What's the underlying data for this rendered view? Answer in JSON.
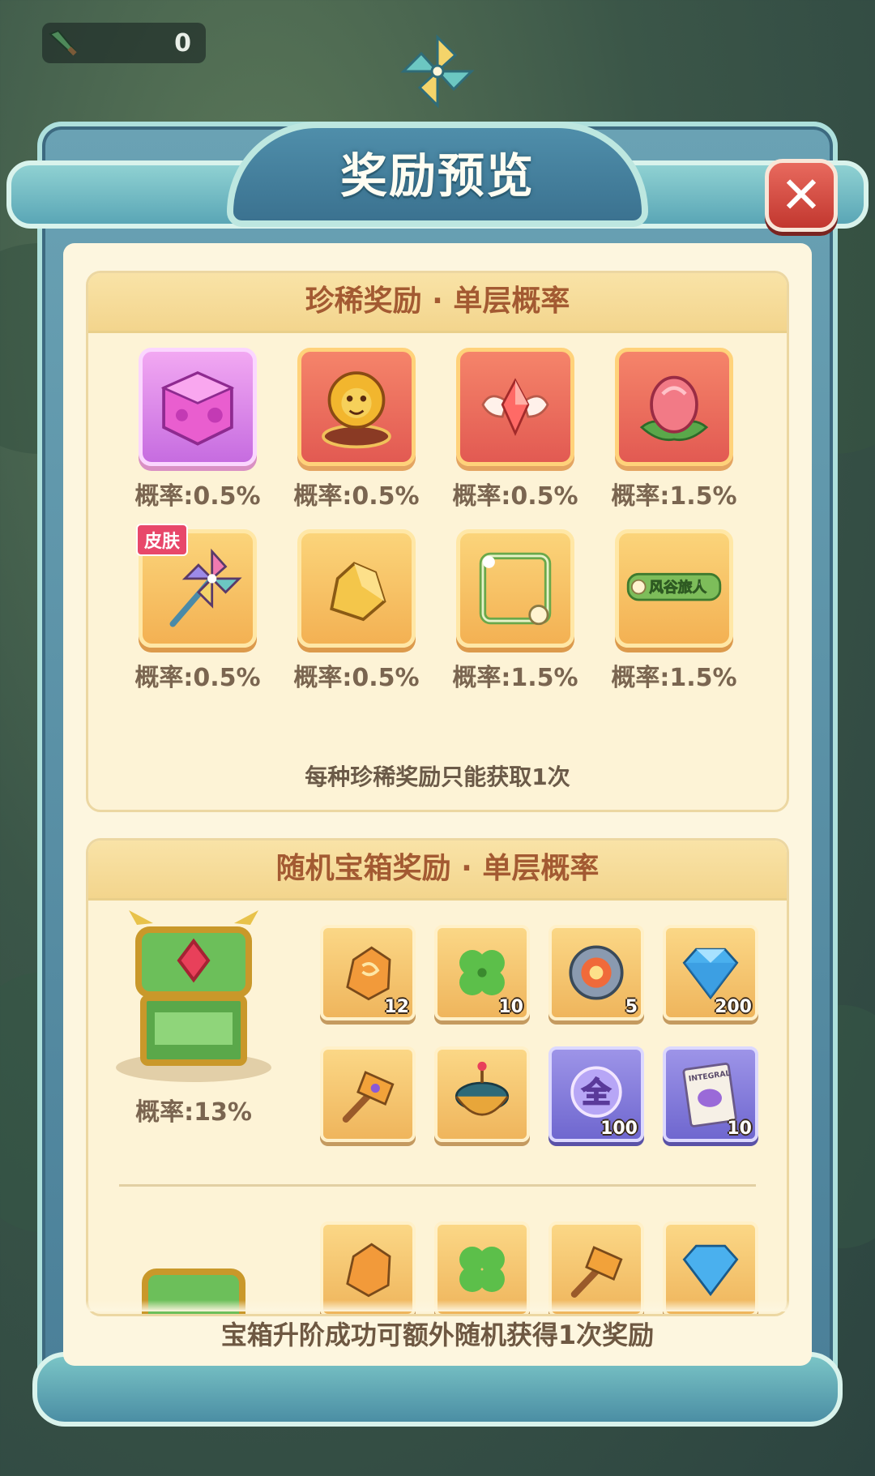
{
  "hud": {
    "counter_value": "0"
  },
  "dialog": {
    "title": "奖励预览",
    "close_icon": "close-icon"
  },
  "rare_section": {
    "header": "珍稀奖励 · 单层概率",
    "items": [
      {
        "name": "magic-cube-icon",
        "badge": "",
        "prob": "概率:0.5%",
        "style": "pink"
      },
      {
        "name": "lion-statue-icon",
        "badge": "",
        "prob": "概率:0.5%",
        "style": "red"
      },
      {
        "name": "winged-gem-icon",
        "badge": "",
        "prob": "概率:0.5%",
        "style": "red"
      },
      {
        "name": "flower-bud-icon",
        "badge": "",
        "prob": "概率:1.5%",
        "style": "red"
      },
      {
        "name": "pinwheel-staff-icon",
        "badge": "皮肤",
        "prob": "概率:0.5%",
        "style": "gold"
      },
      {
        "name": "gold-ore-icon",
        "badge": "",
        "prob": "概率:0.5%",
        "style": "gold"
      },
      {
        "name": "avatar-frame-icon",
        "badge": "",
        "prob": "概率:1.5%",
        "style": "gold"
      },
      {
        "name": "title-plate-icon",
        "badge": "",
        "prob": "概率:1.5%",
        "style": "gold",
        "plate_text": "风谷旅人"
      }
    ],
    "note": "每种珍稀奖励只能获取1次"
  },
  "random_section": {
    "header": "随机宝箱奖励 · 单层概率",
    "chest_1": {
      "icon": "green-gold-chest-icon",
      "prob": "概率:13%",
      "items": [
        {
          "icon": "amber-ore-icon",
          "qty": "12"
        },
        {
          "icon": "clover-icon",
          "qty": "10"
        },
        {
          "icon": "gear-disc-icon",
          "qty": "5"
        },
        {
          "icon": "diamond-icon",
          "qty": "200"
        },
        {
          "icon": "hammer-icon",
          "qty": ""
        },
        {
          "icon": "spinning-top-icon",
          "qty": ""
        },
        {
          "icon": "all-orb-icon",
          "qty": "100",
          "label": "全",
          "purple": true
        },
        {
          "icon": "integral-scroll-icon",
          "qty": "10",
          "label": "INTEGRAL",
          "purple": true
        }
      ]
    },
    "chest_2_items": [
      {
        "icon": "amber-ore-icon"
      },
      {
        "icon": "clover-icon"
      },
      {
        "icon": "hammer-icon"
      },
      {
        "icon": "diamond-icon"
      }
    ]
  },
  "footer": {
    "text": "宝箱升阶成功可额外随机获得1次奖励"
  },
  "colors": {
    "frame": "#4a7f98",
    "panel": "#fdf6df",
    "header_text": "#a35a32",
    "close": "#c2372f"
  }
}
